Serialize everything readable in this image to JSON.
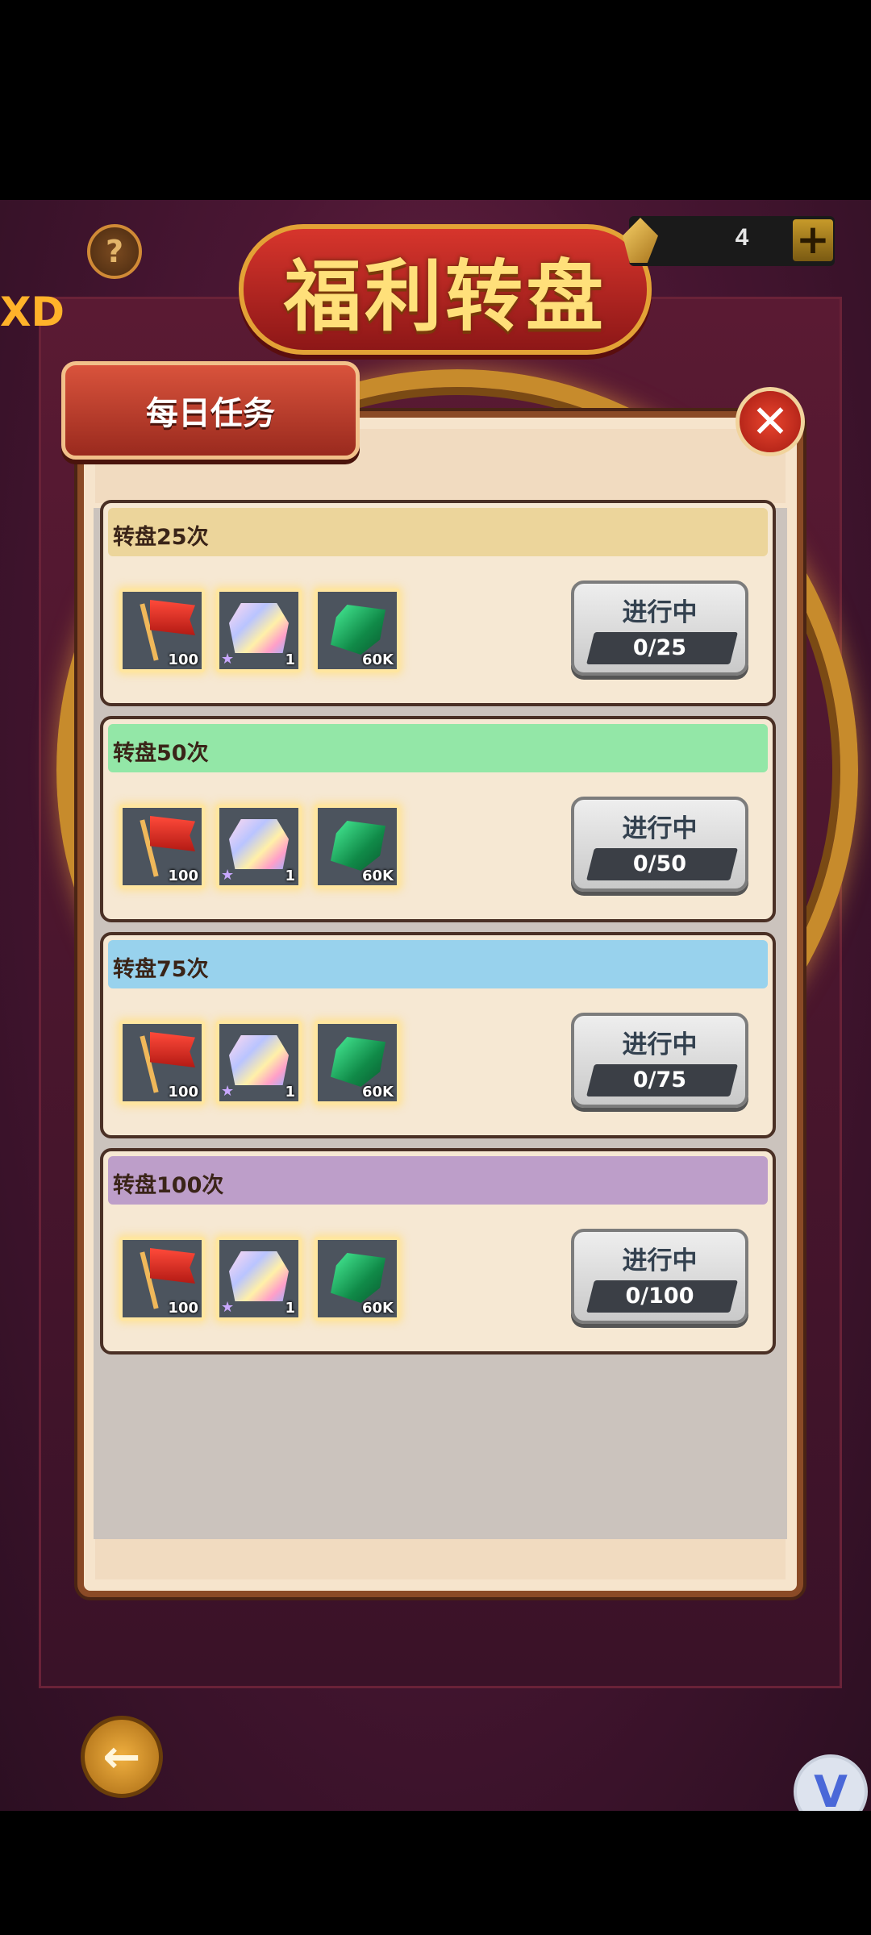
{
  "header": {
    "banner_title": "福利转盘",
    "side_tab_text": "XD",
    "help_icon": "question-mark-icon",
    "currency": {
      "icon": "gold-gem-icon",
      "amount": "4",
      "plus_icon": "plus-icon"
    }
  },
  "dialog": {
    "title": "每日任务",
    "close_icon": "close-icon",
    "tasks": [
      {
        "label": "转盘25次",
        "header_color": "#ecd59b",
        "status": "进行中",
        "progress": "0/25",
        "progress_fraction": 0,
        "rewards": [
          {
            "icon": "red-flag-icon",
            "count": "100"
          },
          {
            "icon": "gem-chest-icon",
            "count": "1"
          },
          {
            "icon": "emerald-ore-icon",
            "count": "60K"
          }
        ]
      },
      {
        "label": "转盘50次",
        "header_color": "#93e7a7",
        "status": "进行中",
        "progress": "0/50",
        "progress_fraction": 0,
        "rewards": [
          {
            "icon": "red-flag-icon",
            "count": "100"
          },
          {
            "icon": "gem-chest-icon",
            "count": "1"
          },
          {
            "icon": "emerald-ore-icon",
            "count": "60K"
          }
        ]
      },
      {
        "label": "转盘75次",
        "header_color": "#98d2ed",
        "status": "进行中",
        "progress": "0/75",
        "progress_fraction": 0,
        "rewards": [
          {
            "icon": "red-flag-icon",
            "count": "100"
          },
          {
            "icon": "gem-chest-icon",
            "count": "1"
          },
          {
            "icon": "emerald-ore-icon",
            "count": "60K"
          }
        ]
      },
      {
        "label": "转盘100次",
        "header_color": "#bd9ec9",
        "status": "进行中",
        "progress": "0/100",
        "progress_fraction": 0,
        "rewards": [
          {
            "icon": "red-flag-icon",
            "count": "100"
          },
          {
            "icon": "gem-chest-icon",
            "count": "1"
          },
          {
            "icon": "emerald-ore-icon",
            "count": "60K"
          }
        ]
      }
    ]
  },
  "footer": {
    "back_icon": "back-arrow-icon",
    "overlay_badge_text": "V"
  }
}
